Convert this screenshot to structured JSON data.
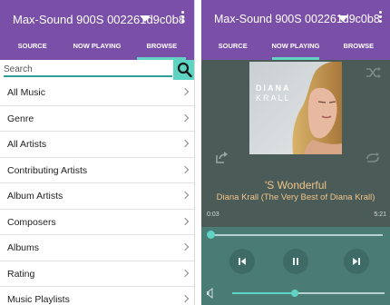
{
  "browse_panel": {
    "device_title": "Max-Sound 900S 002261d9c0b8",
    "tabs": [
      {
        "label": "SOURCE",
        "active": false
      },
      {
        "label": "NOW PLAYING",
        "active": false
      },
      {
        "label": "BROWSE",
        "active": true
      }
    ],
    "search": {
      "placeholder": "Search",
      "value": ""
    },
    "items": [
      {
        "label": "All Music"
      },
      {
        "label": "Genre"
      },
      {
        "label": "All Artists"
      },
      {
        "label": "Contributing Artists"
      },
      {
        "label": "Album Artists"
      },
      {
        "label": "Composers"
      },
      {
        "label": "Albums"
      },
      {
        "label": "Rating"
      },
      {
        "label": "Music Playlists"
      }
    ]
  },
  "now_playing_panel": {
    "device_title": "Max-Sound 900S 002261d9c0b8",
    "tabs": [
      {
        "label": "SOURCE",
        "active": false
      },
      {
        "label": "NOW PLAYING",
        "active": true
      },
      {
        "label": "BROWSE",
        "active": false
      }
    ],
    "album_art_text": {
      "line1": "DIANA",
      "line2": "KRALL"
    },
    "track": {
      "title": "'S Wonderful",
      "artist_album": "Diana Krall (The Very Best of Diana Krall)",
      "elapsed": "0:03",
      "duration": "5:21",
      "progress_fraction": 0.01
    },
    "volume_fraction": 0.41
  },
  "colors": {
    "header": "#7a4fa8",
    "accent": "#5ed5c2",
    "track_text": "#f0c58a",
    "player_bg": "#4b5b57",
    "controls_bg": "#4a7b75"
  }
}
